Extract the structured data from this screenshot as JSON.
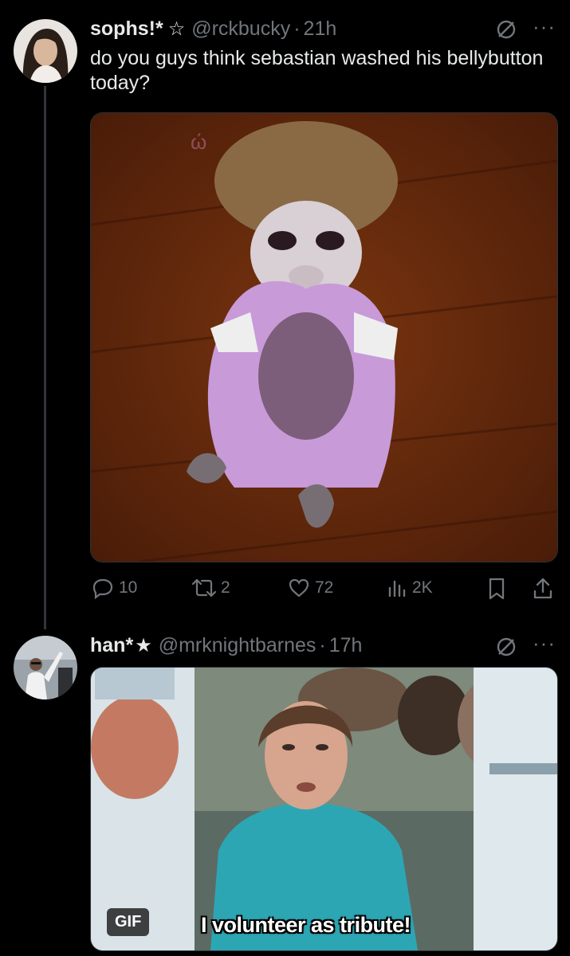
{
  "tweets": [
    {
      "name": "sophs!*",
      "badge_icon": "outline-star-icon",
      "handle": "@rckbucky",
      "time": "21h",
      "text": "do you guys think sebastian washed his bellybutton today?",
      "media": {
        "type": "image",
        "description_icon": "monkey-in-pink-dress-photo"
      },
      "stats": {
        "replies": "10",
        "retweets": "2",
        "likes": "72",
        "views": "2K"
      }
    },
    {
      "name": "han*",
      "badge_icon": "filled-star-icon",
      "handle": "@mrknightbarnes",
      "time": "17h",
      "media": {
        "type": "gif",
        "badge": "GIF",
        "caption": "I volunteer as tribute!"
      }
    }
  ],
  "separator": "·",
  "colors": {
    "background": "#000000",
    "text": "#e7e9ea",
    "muted": "#71767b",
    "line": "#333639"
  }
}
